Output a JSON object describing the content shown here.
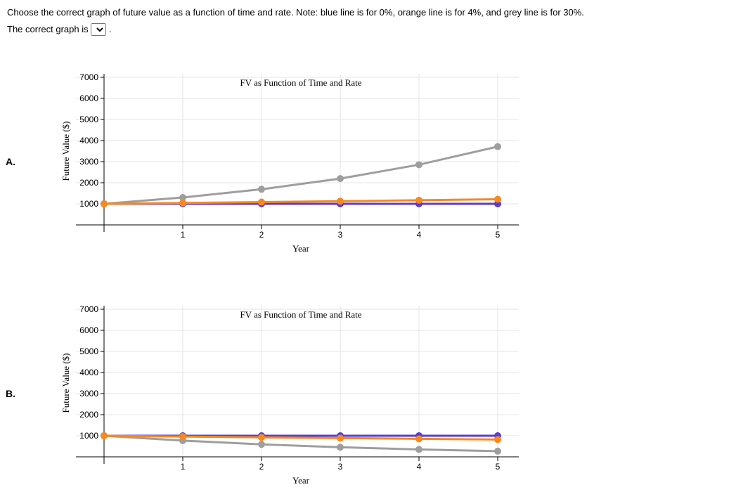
{
  "question": {
    "prompt": "Choose the correct graph of future value as a function of time and rate. Note: blue line is for 0%, orange line is for 4%, and grey line is for 30%.",
    "answer_prefix": "The correct graph is",
    "answer_suffix": ".",
    "select_placeholder": ""
  },
  "labels": {
    "optionA": "A.",
    "optionB": "B."
  },
  "chart_data": [
    {
      "id": "A",
      "type": "line",
      "title": "FV as Function of Time and Rate",
      "xlabel": "Year",
      "ylabel": "Future Value ($)",
      "x": [
        0,
        1,
        2,
        3,
        4,
        5
      ],
      "ylim": [
        0,
        7000
      ],
      "yticks": [
        1000,
        2000,
        3000,
        4000,
        5000,
        6000,
        7000
      ],
      "xticks": [
        1,
        2,
        3,
        4,
        5
      ],
      "series": [
        {
          "name": "0%",
          "color": "blue",
          "values": [
            1000,
            1000,
            1000,
            1000,
            1000,
            1000
          ]
        },
        {
          "name": "4%",
          "color": "orange",
          "values": [
            1000,
            1040,
            1082,
            1125,
            1170,
            1217
          ]
        },
        {
          "name": "30%",
          "color": "grey",
          "values": [
            1000,
            1300,
            1690,
            2197,
            2856,
            3713
          ]
        }
      ]
    },
    {
      "id": "B",
      "type": "line",
      "title": "FV as Function of Time and Rate",
      "xlabel": "Year",
      "ylabel": "Future Value ($)",
      "x": [
        0,
        1,
        2,
        3,
        4,
        5
      ],
      "ylim": [
        0,
        7000
      ],
      "yticks": [
        1000,
        2000,
        3000,
        4000,
        5000,
        6000,
        7000
      ],
      "xticks": [
        1,
        2,
        3,
        4,
        5
      ],
      "series": [
        {
          "name": "0%",
          "color": "blue",
          "values": [
            1000,
            1000,
            1000,
            1000,
            1000,
            1000
          ]
        },
        {
          "name": "4%",
          "color": "orange",
          "values": [
            1000,
            962,
            925,
            889,
            855,
            822
          ]
        },
        {
          "name": "30%",
          "color": "grey",
          "values": [
            1000,
            769,
            592,
            455,
            350,
            269
          ]
        }
      ]
    }
  ]
}
